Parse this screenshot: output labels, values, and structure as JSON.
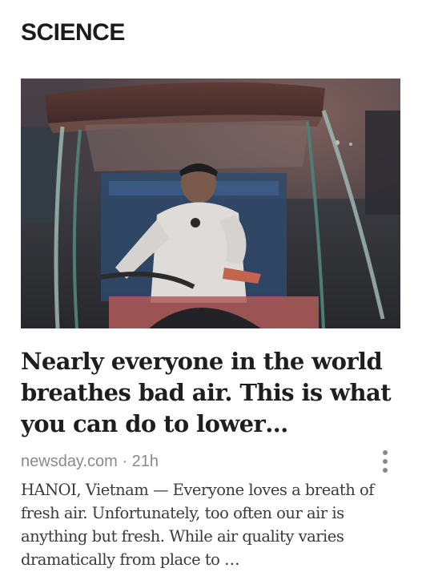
{
  "section": {
    "title": "SCIENCE"
  },
  "article": {
    "headline": "Nearly everyone in the world breathes bad air. This is what you can do to lower…",
    "source": "newsday.com",
    "separator": " · ",
    "age": "21h",
    "summary": "HANOI, Vietnam — Everyone loves a breath of fresh air. Unfortunately, too often our air is anything but fresh. While air quality varies dramatically from place to …",
    "image_icon": "photo-rickshaw-driver",
    "more_icon": "vertical-ellipsis-icon"
  }
}
